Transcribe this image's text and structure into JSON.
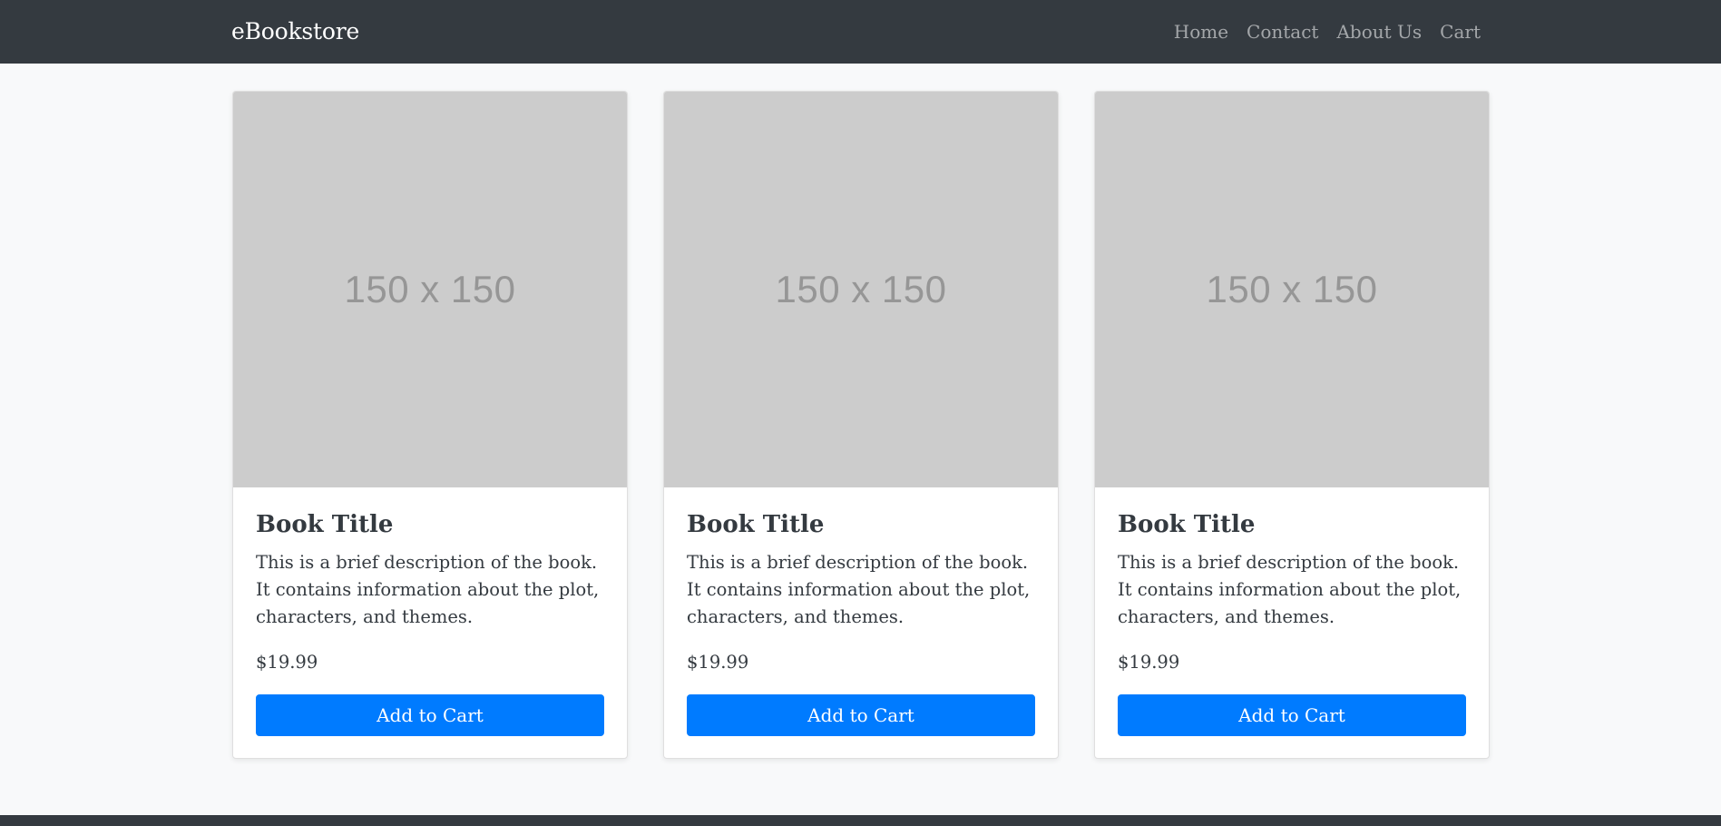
{
  "navbar": {
    "brand": "eBookstore",
    "links": [
      {
        "label": "Home"
      },
      {
        "label": "Contact"
      },
      {
        "label": "About Us"
      },
      {
        "label": "Cart"
      }
    ]
  },
  "books": [
    {
      "image_placeholder": "150 x 150",
      "title": "Book Title",
      "description": "This is a brief description of the book. It contains information about the plot, characters, and themes.",
      "price": "$19.99",
      "button_label": "Add to Cart"
    },
    {
      "image_placeholder": "150 x 150",
      "title": "Book Title",
      "description": "This is a brief description of the book. It contains information about the plot, characters, and themes.",
      "price": "$19.99",
      "button_label": "Add to Cart"
    },
    {
      "image_placeholder": "150 x 150",
      "title": "Book Title",
      "description": "This is a brief description of the book. It contains information about the plot, characters, and themes.",
      "price": "$19.99",
      "button_label": "Add to Cart"
    }
  ],
  "colors": {
    "navbar_bg": "#343a40",
    "page_bg": "#f8f9fa",
    "primary_button": "#007bff",
    "image_placeholder_bg": "#cccccc"
  }
}
